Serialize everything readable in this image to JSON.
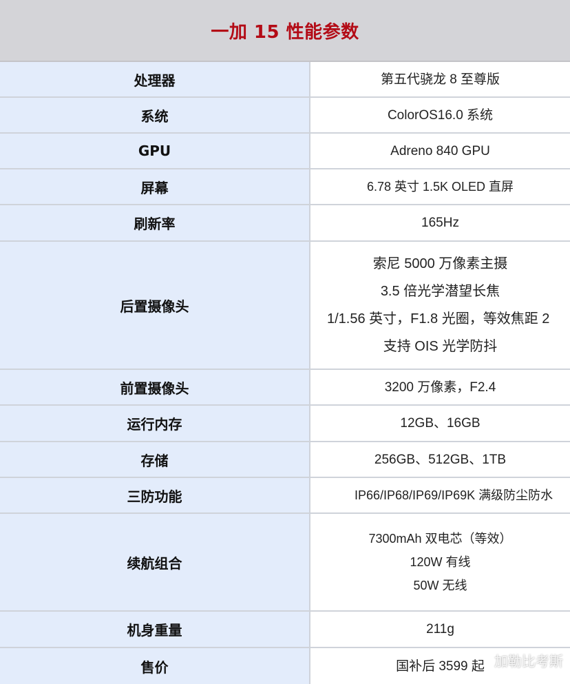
{
  "title": "一加 15 性能参数",
  "rows": [
    {
      "label": "处理器",
      "values": [
        "第五代骁龙 8  至尊版"
      ]
    },
    {
      "label": "系统",
      "values": [
        "ColorOS16.0  系统"
      ]
    },
    {
      "label": "GPU",
      "values": [
        "Adreno 840 GPU"
      ]
    },
    {
      "label": "屏幕",
      "values": [
        "6.78 英寸  1.5K  OLED 直屏"
      ]
    },
    {
      "label": "刷新率",
      "values": [
        "165Hz"
      ]
    },
    {
      "label": "后置摄像头",
      "values": [
        "索尼  5000  万像素主摄",
        "3.5  倍光学潜望长焦",
        "1/1.56 英寸，F1.8 光圈，等效焦距 2",
        "支持 OIS 光学防抖"
      ]
    },
    {
      "label": "前置摄像头",
      "values": [
        "3200 万像素，F2.4"
      ]
    },
    {
      "label": "运行内存",
      "values": [
        "12GB、16GB"
      ]
    },
    {
      "label": "存储",
      "values": [
        "256GB、512GB、1TB"
      ]
    },
    {
      "label": "三防功能",
      "values": [
        "IP66/IP68/IP69/IP69K 满级防尘防水"
      ]
    },
    {
      "label": "续航组合",
      "values": [
        "7300mAh 双电芯（等效）",
        "120W 有线",
        "50W 无线"
      ]
    },
    {
      "label": "机身重量",
      "values": [
        "211g"
      ]
    },
    {
      "label": "售价",
      "values": [
        "国补后 3599 起"
      ]
    }
  ],
  "watermark": "加勒比考斯"
}
